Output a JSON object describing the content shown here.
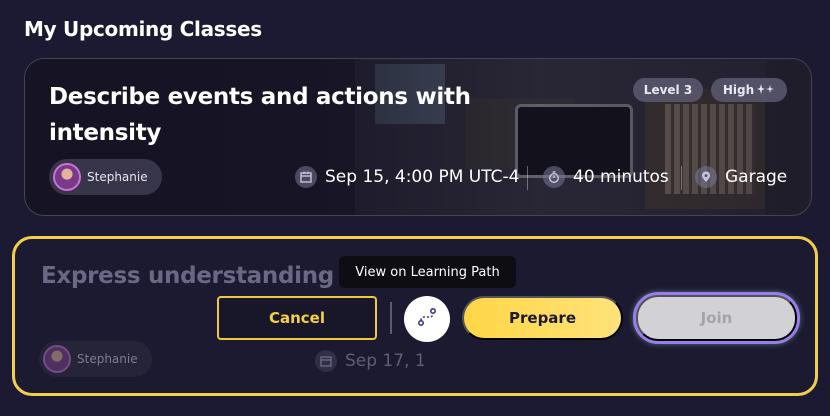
{
  "section_title": "My Upcoming Classes",
  "classes": [
    {
      "title": "Describe events and actions with intensity",
      "level": "Level 3",
      "intensity": "High",
      "intensity_icon": "sparkles-icon",
      "teacher": "Stephanie",
      "date": "Sep 15, 4:00 PM UTC-4",
      "duration": "40 minutos",
      "location": "Garage"
    },
    {
      "title": "Express understanding",
      "teacher": "Stephanie",
      "date": "Sep 17, 1"
    }
  ],
  "actions": {
    "cancel_label": "Cancel",
    "prepare_label": "Prepare",
    "join_label": "Join",
    "learning_path_tooltip": "View on Learning Path"
  },
  "colors": {
    "accent_yellow": "#f2cf4a",
    "background": "#1c1a33",
    "join_disabled": "#d2d2d6"
  }
}
